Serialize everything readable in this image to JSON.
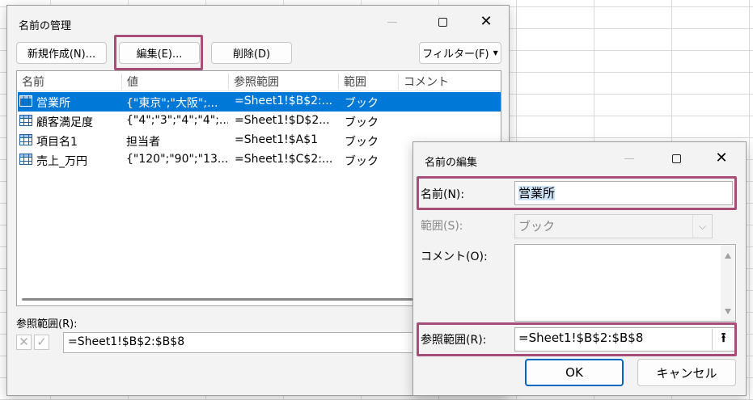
{
  "manager": {
    "title": "名前の管理",
    "buttons": {
      "new": "新規作成(N)...",
      "edit": "編集(E)...",
      "delete": "削除(D)",
      "filter": "フィルター(F)"
    },
    "columns": [
      "名前",
      "値",
      "参照範囲",
      "範囲",
      "コメント"
    ],
    "rows": [
      {
        "name": "営業所",
        "value": "{\"東京\";\"大阪\";...",
        "ref": "=Sheet1!$B$2:...",
        "scope": "ブック",
        "comment": ""
      },
      {
        "name": "顧客満足度",
        "value": "{\"4\";\"3\";\"4\";\"4\";...",
        "ref": "=Sheet1!$D$2...",
        "scope": "ブック",
        "comment": ""
      },
      {
        "name": "項目名1",
        "value": "担当者",
        "ref": "=Sheet1!$A$1",
        "scope": "ブック",
        "comment": ""
      },
      {
        "name": "売上_万円",
        "value": "{\"120\";\"90\";\"13...",
        "ref": "=Sheet1!$C$2:...",
        "scope": "ブック",
        "comment": ""
      }
    ],
    "ref_label": "参照範囲(R):",
    "ref_value": "=Sheet1!$B$2:$B$8"
  },
  "edit": {
    "title": "名前の編集",
    "name_label": "名前(N):",
    "name_value": "営業所",
    "scope_label": "範囲(S):",
    "scope_value": "ブック",
    "comment_label": "コメント(O):",
    "comment_value": "",
    "ref_label": "参照範囲(R):",
    "ref_value": "=Sheet1!$B$2:$B$8",
    "ok": "OK",
    "cancel": "キャンセル"
  },
  "colors": {
    "selection": "#0078d7",
    "highlight": "#a84d78",
    "ok_border": "#0067c0"
  }
}
